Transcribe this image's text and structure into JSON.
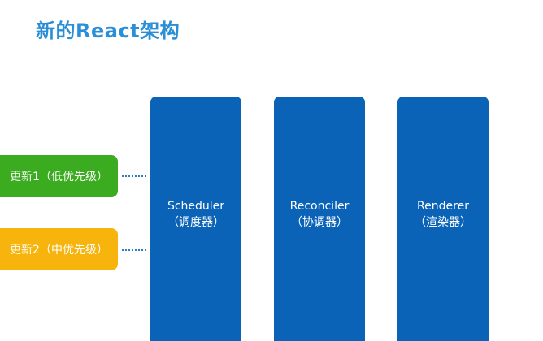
{
  "title": "新的React架构",
  "updates": [
    {
      "label": "更新1（低优先级）",
      "color": "#3bab1f"
    },
    {
      "label": "更新2（中优先级）",
      "color": "#f6b40c"
    }
  ],
  "modules": [
    {
      "name": "Scheduler",
      "subtitle": "（调度器）"
    },
    {
      "name": "Reconciler",
      "subtitle": "（协调器）"
    },
    {
      "name": "Renderer",
      "subtitle": "（渲染器）"
    }
  ],
  "colors": {
    "title": "#2a8fd6",
    "module": "#0b63b8",
    "connector": "#2a7dc2"
  }
}
